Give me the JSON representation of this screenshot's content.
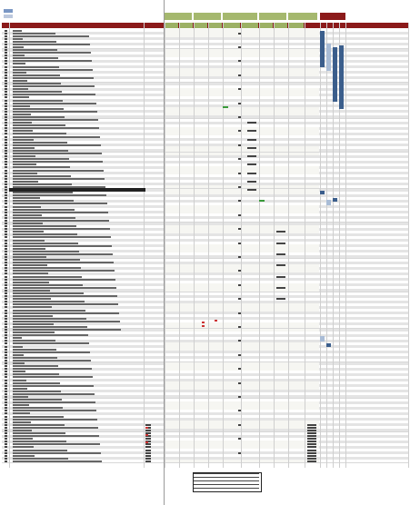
{
  "sheet": {
    "title": "",
    "legend": [
      {
        "label": "",
        "color": "#7a97c4"
      },
      {
        "label": "",
        "color": "#bcc8dd"
      }
    ]
  },
  "colors": {
    "header_red": "#8b1a1a",
    "header_green": "#a5b86e",
    "row_stripe": "#e4e4e4",
    "row_fill": "#f6f6f2",
    "accent_blue": "#3b5e8c",
    "light_blue": "#a9bcd6"
  },
  "columns": [
    {
      "key": "name",
      "label": ""
    },
    {
      "key": "code",
      "label": ""
    },
    {
      "key": "c1",
      "label": ""
    },
    {
      "key": "c2",
      "label": ""
    },
    {
      "key": "c3",
      "label": ""
    },
    {
      "key": "c4",
      "label": ""
    },
    {
      "key": "c5",
      "label": ""
    },
    {
      "key": "c6",
      "label": ""
    },
    {
      "key": "c7",
      "label": ""
    },
    {
      "key": "c8",
      "label": ""
    },
    {
      "key": "c9",
      "label": ""
    },
    {
      "key": "c10",
      "label": ""
    },
    {
      "key": "notes",
      "label": ""
    }
  ],
  "groups": [
    {
      "label": ""
    },
    {
      "label": ""
    },
    {
      "label": ""
    },
    {
      "label": ""
    },
    {
      "label": ""
    },
    {
      "label": ""
    }
  ]
}
